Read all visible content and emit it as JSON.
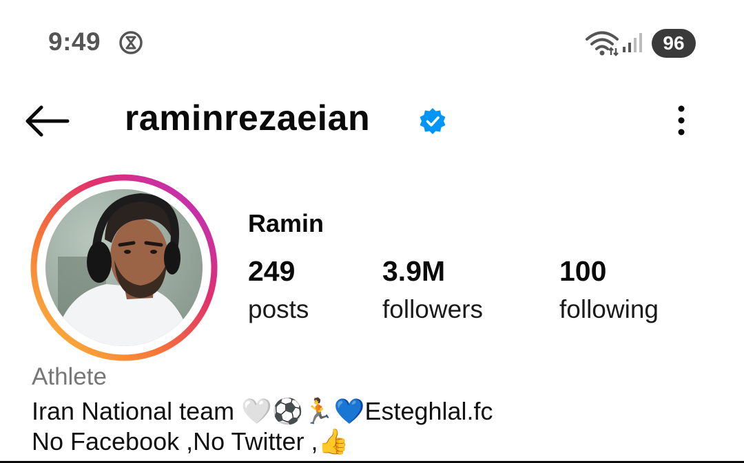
{
  "status_bar": {
    "time": "9:49",
    "battery": "96",
    "icons": [
      "alarm-icon",
      "wifi-icon",
      "signal-icon"
    ]
  },
  "header": {
    "username": "raminrezaeian",
    "verified": true,
    "back_icon": "arrow-left-icon",
    "menu_icon": "more-vertical-icon"
  },
  "profile": {
    "display_name": "Ramin",
    "stats": {
      "posts_count": "249",
      "posts_label": "posts",
      "followers_count": "3.9M",
      "followers_label": "followers",
      "following_count": "100",
      "following_label": "following"
    },
    "category": "Athlete",
    "bio": {
      "line1": "Iran National team 🤍⚽🏃💙Esteghlal.fc",
      "line2": "No Facebook ,No Twitter ,👍"
    }
  },
  "colors": {
    "verified_blue": "#0095f6",
    "story_ring_start": "#fcaf45",
    "story_ring_end": "#c13584",
    "status_gray": "#555555",
    "category_gray": "#777777"
  }
}
